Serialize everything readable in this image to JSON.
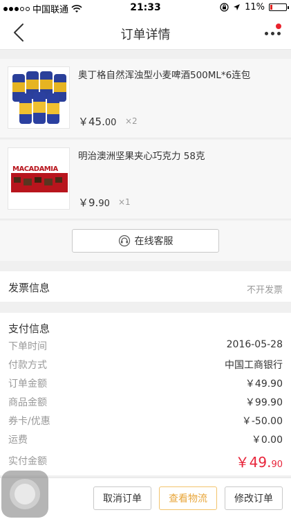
{
  "status_bar": {
    "carrier": "中国联通",
    "time": "21:33",
    "battery": "11%"
  },
  "nav": {
    "title": "订单详情"
  },
  "products": [
    {
      "name": "奥丁格自然浑浊型小麦啤酒500ML*6连包",
      "price_main": "￥45.",
      "price_cents": "00",
      "qty": "×2"
    },
    {
      "name": "明治澳洲坚果夹心巧克力 58克",
      "price_main": "￥9.",
      "price_cents": "90",
      "qty": "×1",
      "thumb_label": "MACADAMIA"
    }
  ],
  "service": {
    "label": "在线客服"
  },
  "invoice": {
    "label": "发票信息",
    "value": "不开发票"
  },
  "payment": {
    "title": "支付信息",
    "rows": [
      {
        "key": "下单时间",
        "value": "2016-05-28"
      },
      {
        "key": "付款方式",
        "value": "中国工商银行"
      },
      {
        "key": "订单金额",
        "value": "￥49.90"
      },
      {
        "key": "商品金额",
        "value": "￥99.90"
      },
      {
        "key": "券卡/优惠",
        "value": "￥-50.00"
      },
      {
        "key": "运费",
        "value": "￥0.00"
      }
    ],
    "total_key": "实付金额",
    "total_main": "￥49.",
    "total_cents": "90"
  },
  "actions": {
    "cancel": "取消订单",
    "logistics": "查看物流",
    "modify": "修改订单"
  },
  "colors": {
    "accent_red": "#e8243a",
    "logistics_orange": "#e8a63a"
  }
}
